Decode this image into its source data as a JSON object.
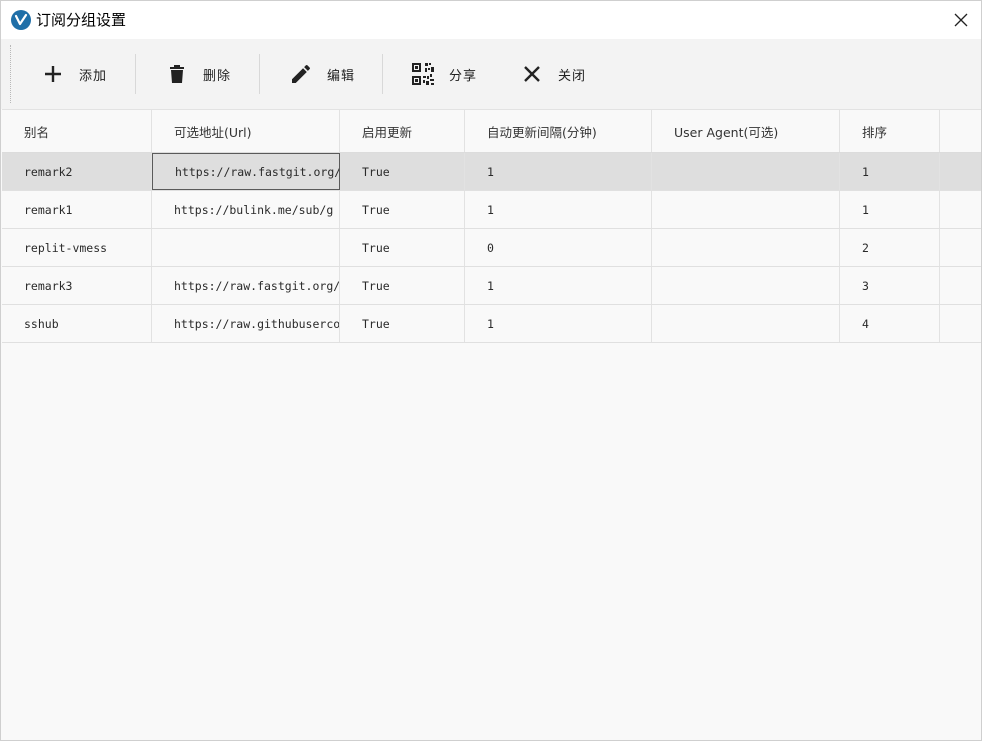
{
  "window": {
    "title": "订阅分组设置"
  },
  "toolbar": {
    "add_label": "添加",
    "delete_label": "删除",
    "edit_label": "编辑",
    "share_label": "分享",
    "close_label": "关闭"
  },
  "table": {
    "headers": [
      "别名",
      "可选地址(Url)",
      "启用更新",
      "自动更新间隔(分钟)",
      "User Agent(可选)",
      "排序",
      ""
    ],
    "rows": [
      [
        "remark2",
        "https://raw.fastgit.org/r",
        "True",
        "1",
        "",
        "1",
        ""
      ],
      [
        "remark1",
        "https://bulink.me/sub/g",
        "True",
        "1",
        "",
        "1",
        ""
      ],
      [
        "replit-vmess",
        "",
        "True",
        "0",
        "",
        "2",
        ""
      ],
      [
        "remark3",
        "https://raw.fastgit.org/l",
        "True",
        "1",
        "",
        "3",
        ""
      ],
      [
        "sshub",
        "https://raw.githubuserco",
        "True",
        "1",
        "",
        "4",
        ""
      ]
    ]
  },
  "colors": {
    "selected_row": "#dedede",
    "app_icon": "#1f6fa8"
  }
}
